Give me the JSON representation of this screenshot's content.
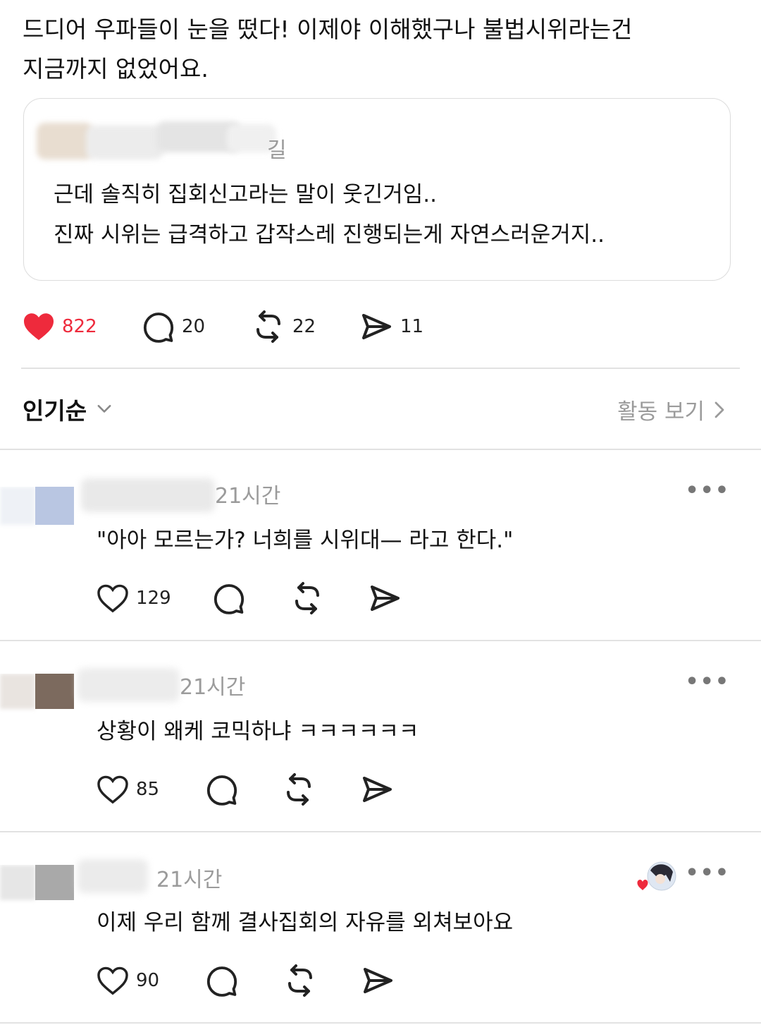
{
  "post": {
    "text_line1": "드디어 우파들이 눈을 떴다! 이제야 이해했구나 불법시위라는건",
    "text_line2": "지금까지 없었어요.",
    "quote": {
      "author_tail": "길",
      "line1": "근데 솔직히 집회신고라는 말이 웃긴거임..",
      "line2": "진짜 시위는 급격하고 갑작스레 진행되는게 자연스러운거지.."
    },
    "likes": "822",
    "comments": "20",
    "reposts": "22",
    "shares": "11",
    "liked": true,
    "colors": {
      "like": "#ee2a3c",
      "muted": "#9b9b9b",
      "divider": "#e2e2e2"
    }
  },
  "sort": {
    "label": "인기순",
    "activity": "활동 보기"
  },
  "replies": [
    {
      "time": "21시간",
      "text": "\"아아 모르는가? 너희를 시위대— 라고 한다.\"",
      "likes": "129"
    },
    {
      "time": "21시간",
      "text": "상황이 왜케 코믹하냐 ㅋㅋㅋㅋㅋㅋ",
      "likes": "85"
    },
    {
      "time": "21시간",
      "text": "이제 우리 함께 결사집회의 자유를 외쳐보아요",
      "likes": "90",
      "liked_by_author": true
    }
  ],
  "icons": [
    "heart-icon",
    "comment-icon",
    "repost-icon",
    "share-icon",
    "chevron-down-icon",
    "chevron-right-icon",
    "more-icon"
  ]
}
